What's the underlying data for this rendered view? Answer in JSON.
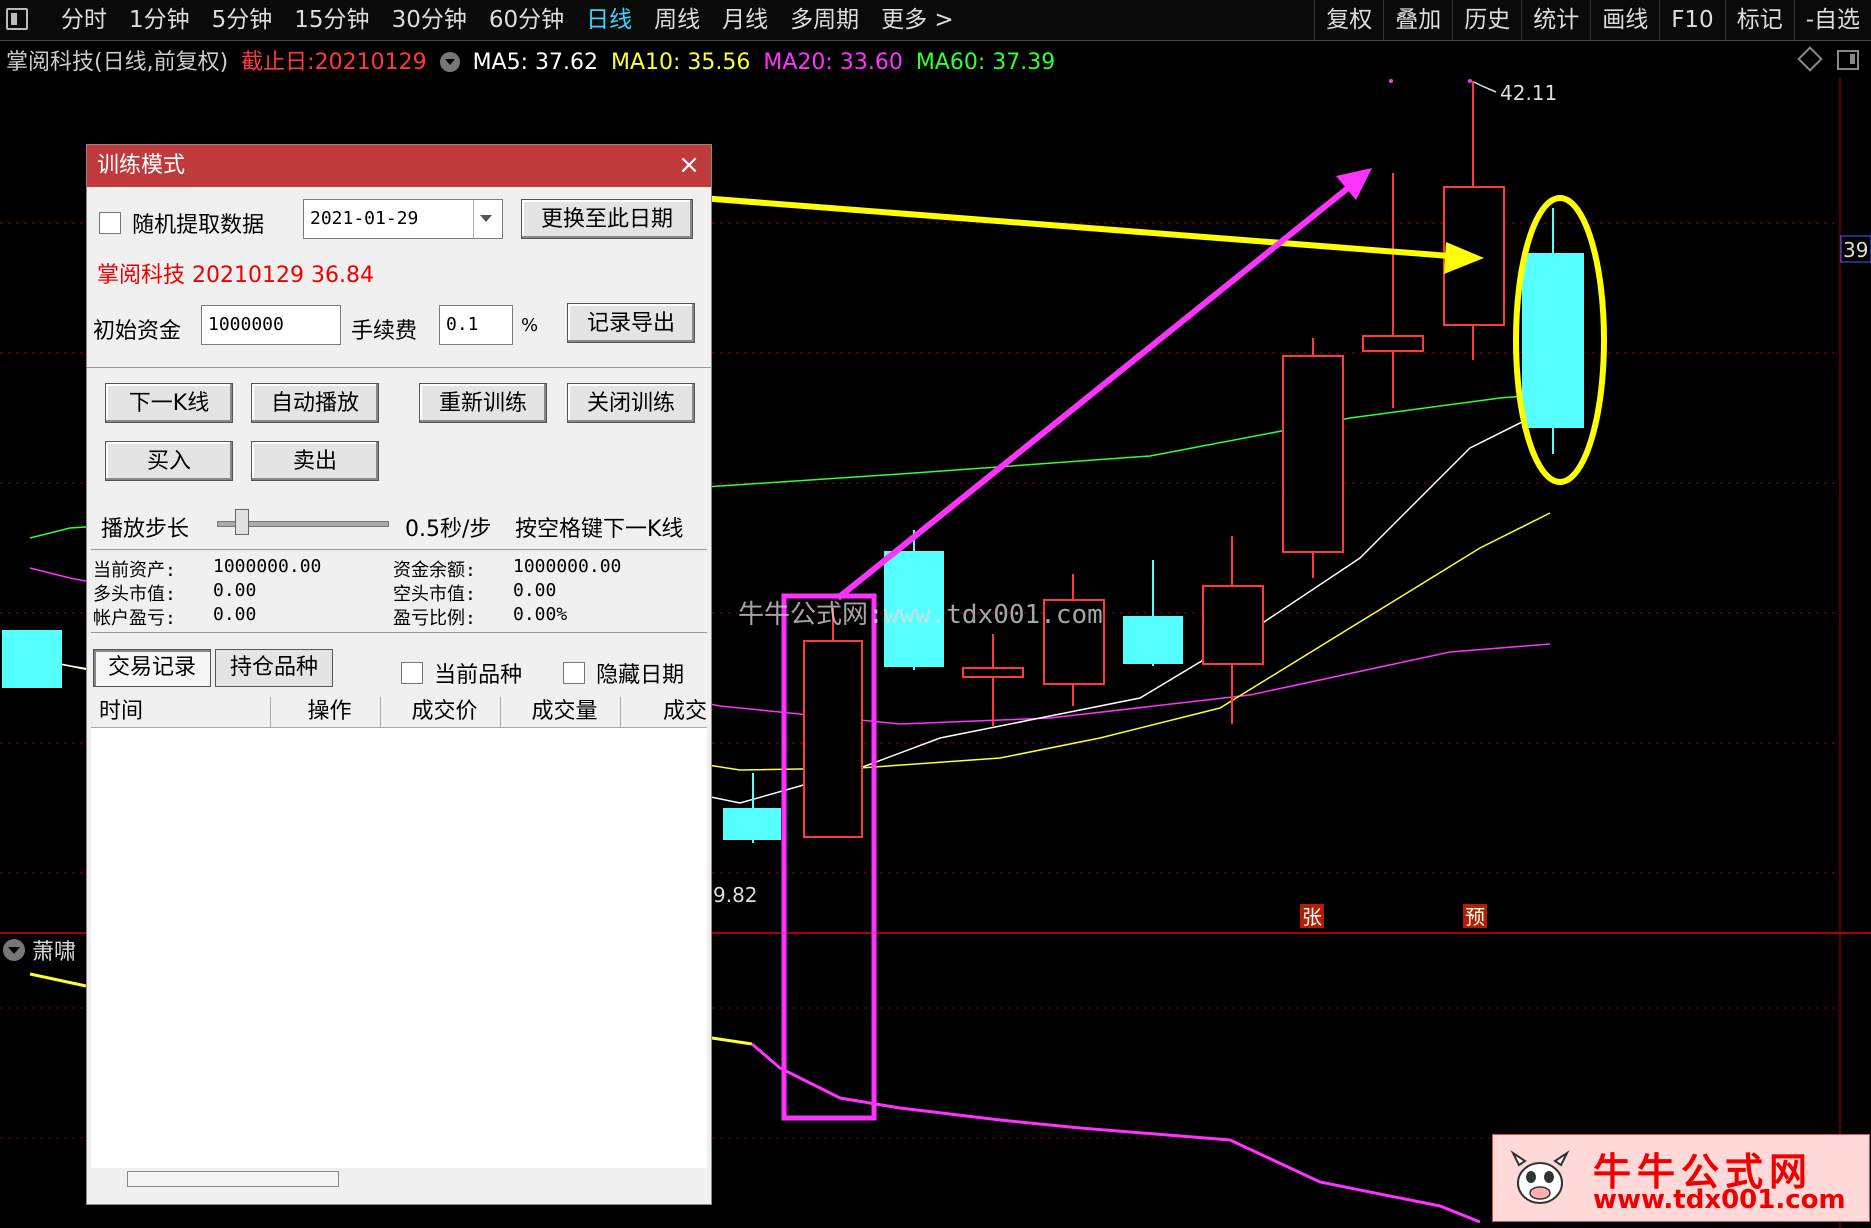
{
  "toolbar": {
    "periods": [
      "分时",
      "1分钟",
      "5分钟",
      "15分钟",
      "30分钟",
      "60分钟",
      "日线",
      "周线",
      "月线",
      "多周期",
      "更多 >"
    ],
    "active_period": "日线",
    "right_tools": [
      "复权",
      "叠加",
      "历史",
      "统计",
      "画线",
      "F10",
      "标记",
      "-自选"
    ]
  },
  "title": {
    "stock": "掌阅科技(日线,前复权)",
    "cutoff": "截止日:20210129",
    "ma5": "MA5: 37.62",
    "ma10": "MA10: 35.56",
    "ma20": "MA20: 33.60",
    "ma60": "MA60: 37.39"
  },
  "chart_labels": {
    "high_price": "42.11",
    "low_price": "9.82",
    "axis_price": "39",
    "marker_zhang": "张",
    "marker_yu": "预",
    "sub_indicator": "萧啸"
  },
  "colors": {
    "bull": "#ff3a3a",
    "bear": "#55ffff",
    "ma5": "#ffffff",
    "ma10": "#ffff33",
    "ma20": "#ff33ff",
    "ma60": "#33ff33",
    "annotation_yellow": "#ffff00",
    "annotation_magenta": "#ff33ff"
  },
  "dialog": {
    "title": "训练模式",
    "random_label": "随机提取数据",
    "date_value": "2021-01-29",
    "change_date_button": "更换至此日期",
    "stock_info": "掌阅科技 20210129 36.84",
    "init_fund_label": "初始资金",
    "init_fund_value": "1000000",
    "fee_label": "手续费",
    "fee_value": "0.1",
    "fee_unit": "%",
    "export_button": "记录导出",
    "next_k_button": "下一K线",
    "autoplay_button": "自动播放",
    "retrain_button": "重新训练",
    "close_train_button": "关闭训练",
    "buy_button": "买入",
    "sell_button": "卖出",
    "step_label": "播放步长",
    "step_value": 0.1,
    "step_text": "0.5秒/步",
    "space_hint": "按空格键下一K线",
    "stats": {
      "asset_label": "当前资产:",
      "asset_value": "1000000.00",
      "cash_label": "资金余额:",
      "cash_value": "1000000.00",
      "long_label": "多头市值:",
      "long_value": "0.00",
      "short_label": "空头市值:",
      "short_value": "0.00",
      "pl_label": "帐户盈亏:",
      "pl_value": "0.00",
      "ratio_label": "盈亏比例:",
      "ratio_value": "0.00%"
    },
    "tab_records": "交易记录",
    "tab_holdings": "持仓品种",
    "current_label": "当前品种",
    "hide_date_label": "隐藏日期",
    "columns": [
      "时间",
      "操作",
      "成交价",
      "成交量",
      "成交"
    ]
  },
  "watermark": "牛牛公式网:www.tdx001.com",
  "logo": {
    "name": "牛牛公式网",
    "url": "www.tdx001.com"
  }
}
